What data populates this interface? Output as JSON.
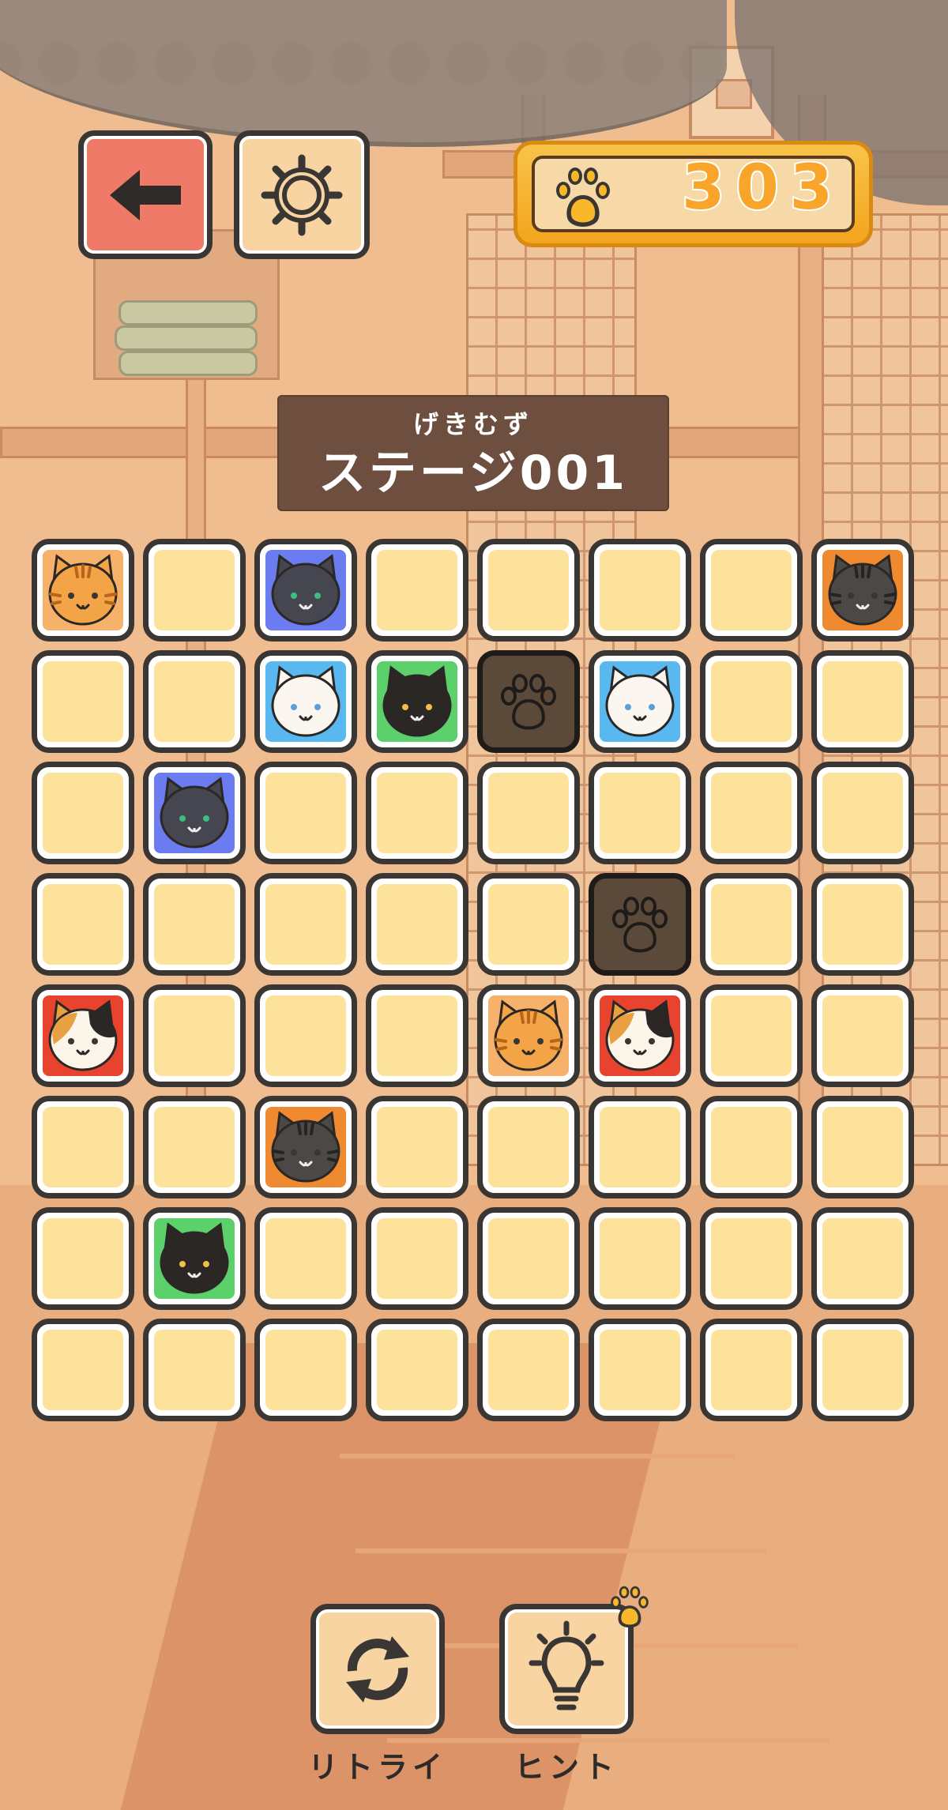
{
  "topbar": {
    "back_icon": "arrow-left-icon",
    "settings_icon": "gear-icon",
    "coins": {
      "icon": "paw-icon",
      "value": "303"
    }
  },
  "stage": {
    "subtitle": "げきむず",
    "title": "ステージ001"
  },
  "board": {
    "rows": 8,
    "cols": 8,
    "cells": [
      [
        "tabby",
        "",
        "gray",
        "",
        "",
        "",
        "",
        "darktabby"
      ],
      [
        "",
        "",
        "white",
        "black",
        "paw",
        "white",
        "",
        ""
      ],
      [
        "",
        "gray",
        "",
        "",
        "",
        "",
        "",
        ""
      ],
      [
        "",
        "",
        "",
        "",
        "",
        "paw",
        "",
        ""
      ],
      [
        "calico",
        "",
        "",
        "",
        "tabby",
        "calico",
        "",
        ""
      ],
      [
        "",
        "",
        "darktabby",
        "",
        "",
        "",
        "",
        ""
      ],
      [
        "",
        "black",
        "",
        "",
        "",
        "",
        "",
        ""
      ],
      [
        "",
        "",
        "",
        "",
        "",
        "",
        "",
        ""
      ]
    ],
    "cat_colors": {
      "tabby": "#f6b26b",
      "gray": "#6b7cf0",
      "darktabby": "#f08a30",
      "white": "#59b8f0",
      "black": "#5cd06a",
      "calico": "#e8432e"
    }
  },
  "controls": {
    "retry_label": "リトライ",
    "hint_label": "ヒント",
    "retry_icon": "refresh-icon",
    "hint_icon": "lightbulb-icon"
  }
}
